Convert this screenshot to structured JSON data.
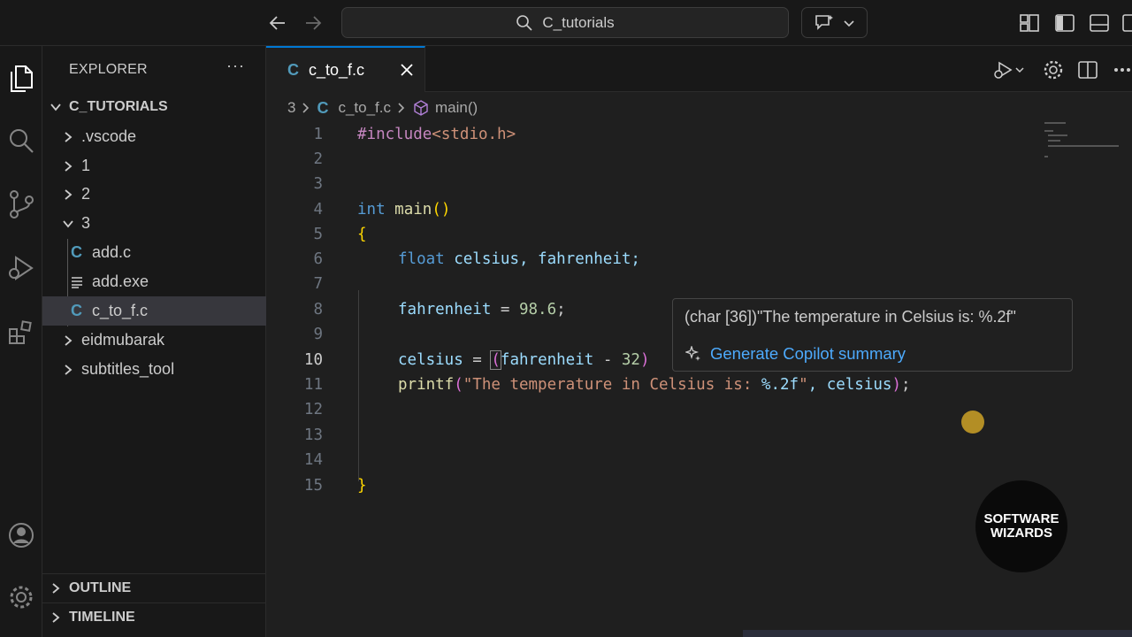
{
  "titlebar": {
    "search_text": "C_tutorials"
  },
  "sidebar": {
    "title": "EXPLORER",
    "more": "···",
    "root": "C_TUTORIALS",
    "items": [
      {
        "label": ".vscode",
        "type": "folder"
      },
      {
        "label": "1",
        "type": "folder"
      },
      {
        "label": "2",
        "type": "folder"
      },
      {
        "label": "3",
        "type": "folder-open"
      },
      {
        "label": "add.c",
        "type": "c-file"
      },
      {
        "label": "add.exe",
        "type": "exe"
      },
      {
        "label": "c_to_f.c",
        "type": "c-file",
        "selected": true
      },
      {
        "label": "eidmubarak",
        "type": "folder"
      },
      {
        "label": "subtitles_tool",
        "type": "folder"
      }
    ],
    "outline": "OUTLINE",
    "timeline": "TIMELINE"
  },
  "editor": {
    "tab_label": "c_to_f.c",
    "tab_icon": "C",
    "breadcrumb": {
      "folder": "3",
      "file": "c_to_f.c",
      "symbol": "main()"
    },
    "line_numbers": [
      "1",
      "2",
      "3",
      "4",
      "5",
      "6",
      "7",
      "8",
      "9",
      "10",
      "11",
      "12",
      "13",
      "14",
      "15"
    ],
    "current_line": "10",
    "code": {
      "l1_pp": "#include",
      "l1_hdr": "<stdio.h>",
      "l4_kw": "int",
      "l4_fn": "main",
      "l4_paren": "()",
      "l5": "{",
      "l6_kw": "float",
      "l6_rest": "celsius, fahrenheit;",
      "l8_var": "fahrenheit",
      "l8_eq": " = ",
      "l8_num": "98.6",
      "l8_end": ";",
      "l10_var": "celsius",
      "l10_eq": " = ",
      "l10_paren": "(",
      "l10_var2": "fahrenheit",
      "l10_op": " - ",
      "l10_num": "32",
      "l10_close": ")",
      "l11_fn": "printf",
      "l11_open": "(",
      "l11_str": "\"The temperature in Celsius is: ",
      "l11_fmt": "%.2f",
      "l11_strend": "\"",
      "l11_rest": ", celsius",
      "l11_close": ")",
      "l11_semi": ";",
      "l15": "}"
    }
  },
  "hover": {
    "signature": "(char [36])\"The temperature in Celsius is: %.2f\"",
    "action": "Generate Copilot summary"
  },
  "badge": {
    "line1": "SOFTWARE",
    "line2": "WIZARDS"
  },
  "colors": {
    "accent": "#0078d4",
    "link": "#4daafc",
    "c_icon": "#519aba"
  }
}
